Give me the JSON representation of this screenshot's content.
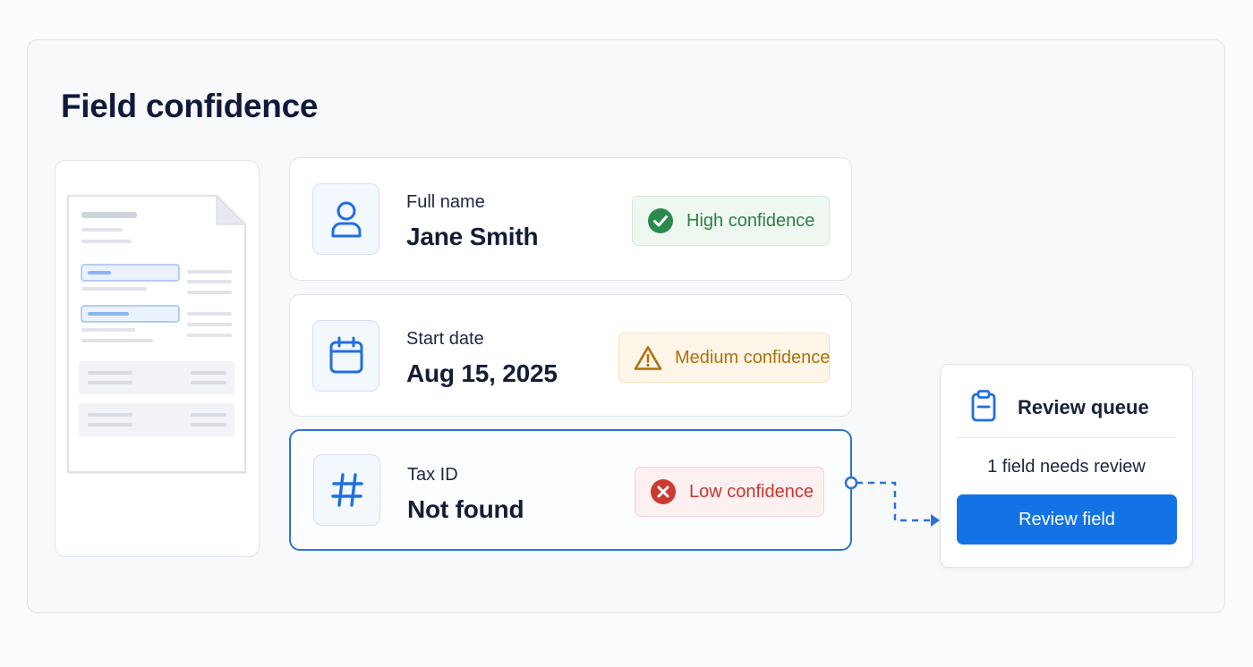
{
  "page": {
    "title": "Field confidence"
  },
  "fields": [
    {
      "label": "Full name",
      "value": "Jane Smith",
      "icon": "user-icon",
      "confidence": {
        "label": "High confidence",
        "level": "high",
        "icon": "check-circle-icon",
        "color": "#2d7d46"
      }
    },
    {
      "label": "Start date",
      "value": "Aug 15, 2025",
      "icon": "calendar-icon",
      "confidence": {
        "label": "Medium confidence",
        "level": "medium",
        "icon": "warning-triangle-icon",
        "color": "#b06f0a"
      }
    },
    {
      "label": "Tax ID",
      "value": "Not found",
      "icon": "hash-icon",
      "confidence": {
        "label": "Low confidence",
        "level": "low",
        "icon": "x-circle-icon",
        "color": "#c9362f"
      }
    }
  ],
  "review_queue": {
    "title": "Review queue",
    "icon": "clipboard-icon",
    "status": "1 field needs review",
    "button_label": "Review field"
  },
  "colors": {
    "accent": "#1373e6",
    "selected_border": "#2c72d6"
  }
}
